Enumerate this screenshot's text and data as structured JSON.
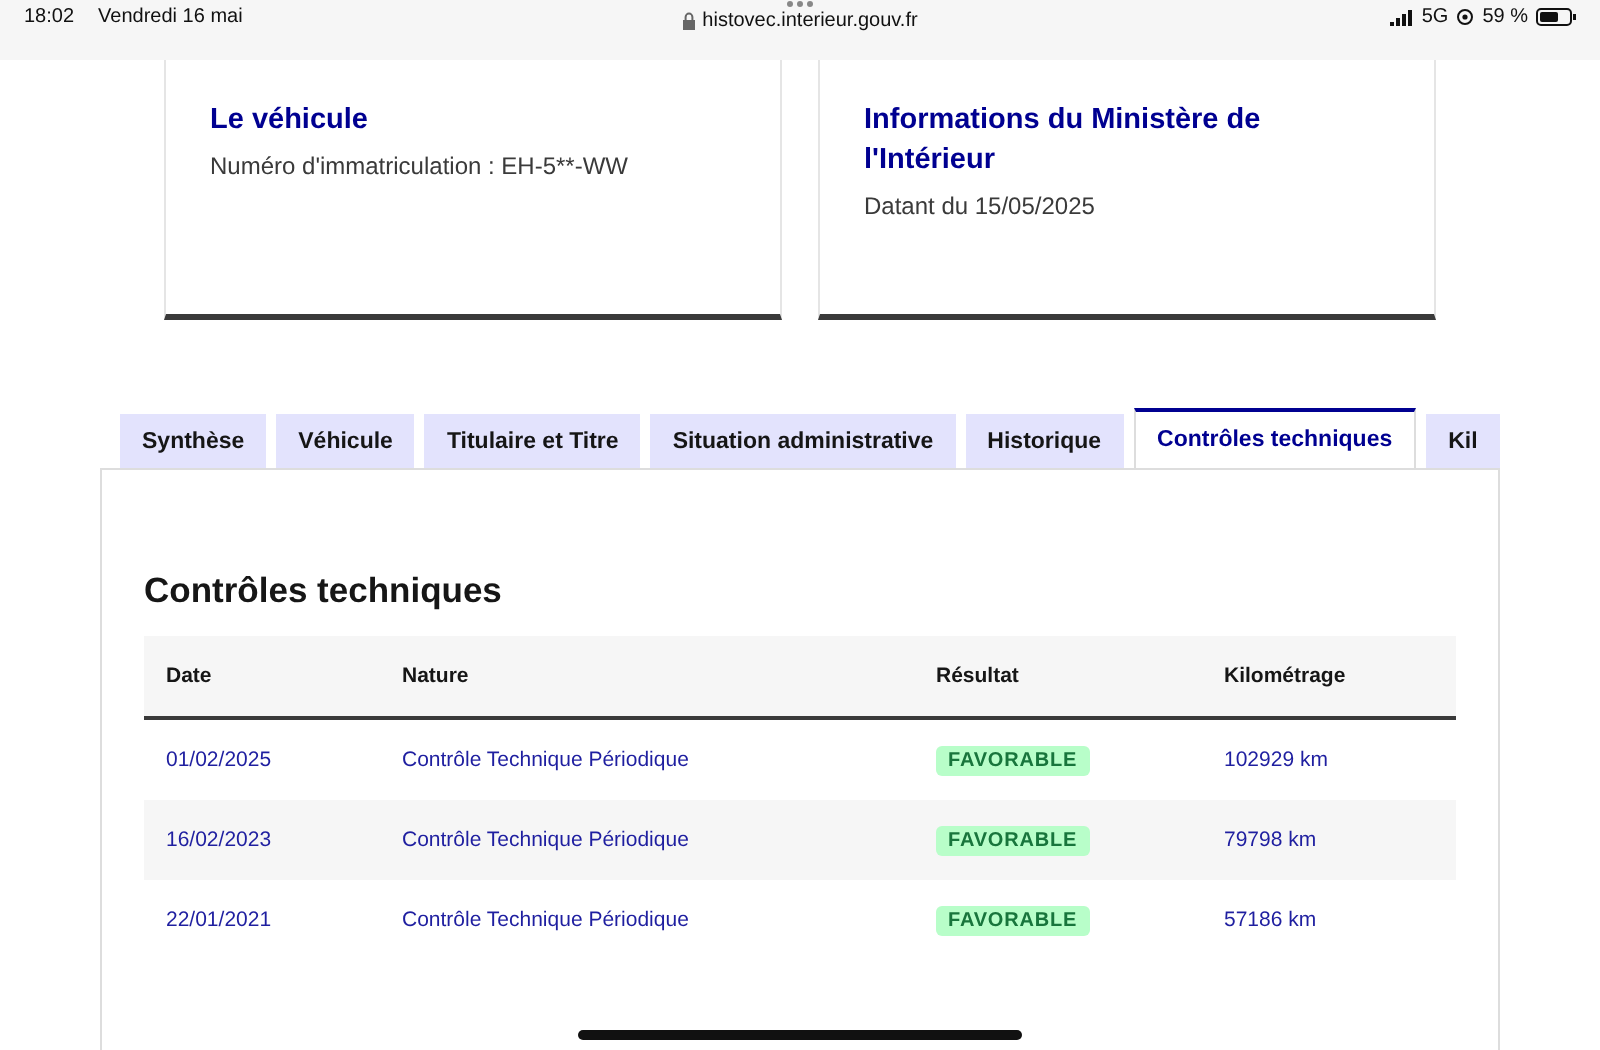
{
  "status_bar": {
    "time": "18:02",
    "date": "Vendredi 16 mai",
    "url": "histovec.interieur.gouv.fr",
    "network": "5G",
    "battery": "59 %"
  },
  "cards": [
    {
      "title": "Le véhicule",
      "text": "Numéro d'immatriculation : EH-5**-WW"
    },
    {
      "title": "Informations du Ministère de l'Intérieur",
      "text": "Datant du 15/05/2025"
    }
  ],
  "tabs": [
    {
      "label": "Synthèse",
      "selected": false
    },
    {
      "label": "Véhicule",
      "selected": false
    },
    {
      "label": "Titulaire et Titre",
      "selected": false
    },
    {
      "label": "Situation administrative",
      "selected": false
    },
    {
      "label": "Historique",
      "selected": false
    },
    {
      "label": "Contrôles techniques",
      "selected": true
    },
    {
      "label": "Kil",
      "selected": false
    }
  ],
  "section_title": "Contrôles techniques",
  "table": {
    "columns": [
      "Date",
      "Nature",
      "Résultat",
      "Kilométrage"
    ],
    "rows": [
      {
        "date": "01/02/2025",
        "nature": "Contrôle Technique Périodique",
        "result": {
          "label": "FAVORABLE",
          "kind": "success"
        },
        "km": "102929 km"
      },
      {
        "date": "16/02/2023",
        "nature": "Contrôle Technique Périodique",
        "result": {
          "label": "FAVORABLE",
          "kind": "success"
        },
        "km": "79798 km"
      },
      {
        "date": "22/01/2021",
        "nature": "Contrôle Technique Périodique",
        "result": {
          "label": "FAVORABLE",
          "kind": "success"
        },
        "km": "57186 km"
      }
    ]
  }
}
